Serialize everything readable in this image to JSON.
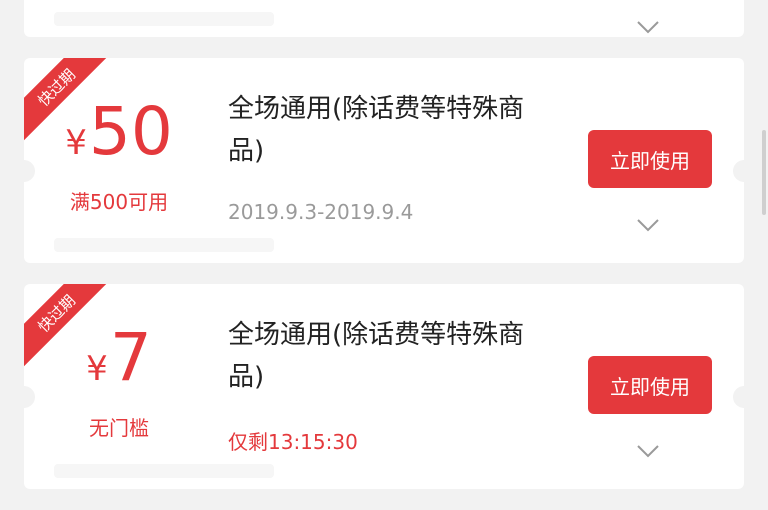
{
  "coupons": [
    {
      "tag": "快过期",
      "currency": "¥",
      "value": "50",
      "condition": "满500可用",
      "title": "全场通用(除话费等特殊商品)",
      "validity": "2019.9.3-2019.9.4",
      "button": "立即使用"
    },
    {
      "tag": "快过期",
      "currency": "¥",
      "value": "7",
      "condition": "无门槛",
      "title": "全场通用(除话费等特殊商品)",
      "validity": "仅剩13:15:30",
      "button": "立即使用"
    }
  ],
  "colors": {
    "accent": "#e4393c",
    "muted": "#9a9a9a",
    "background": "#f2f2f2"
  },
  "icons": {
    "expand": "chevron-down-icon"
  }
}
